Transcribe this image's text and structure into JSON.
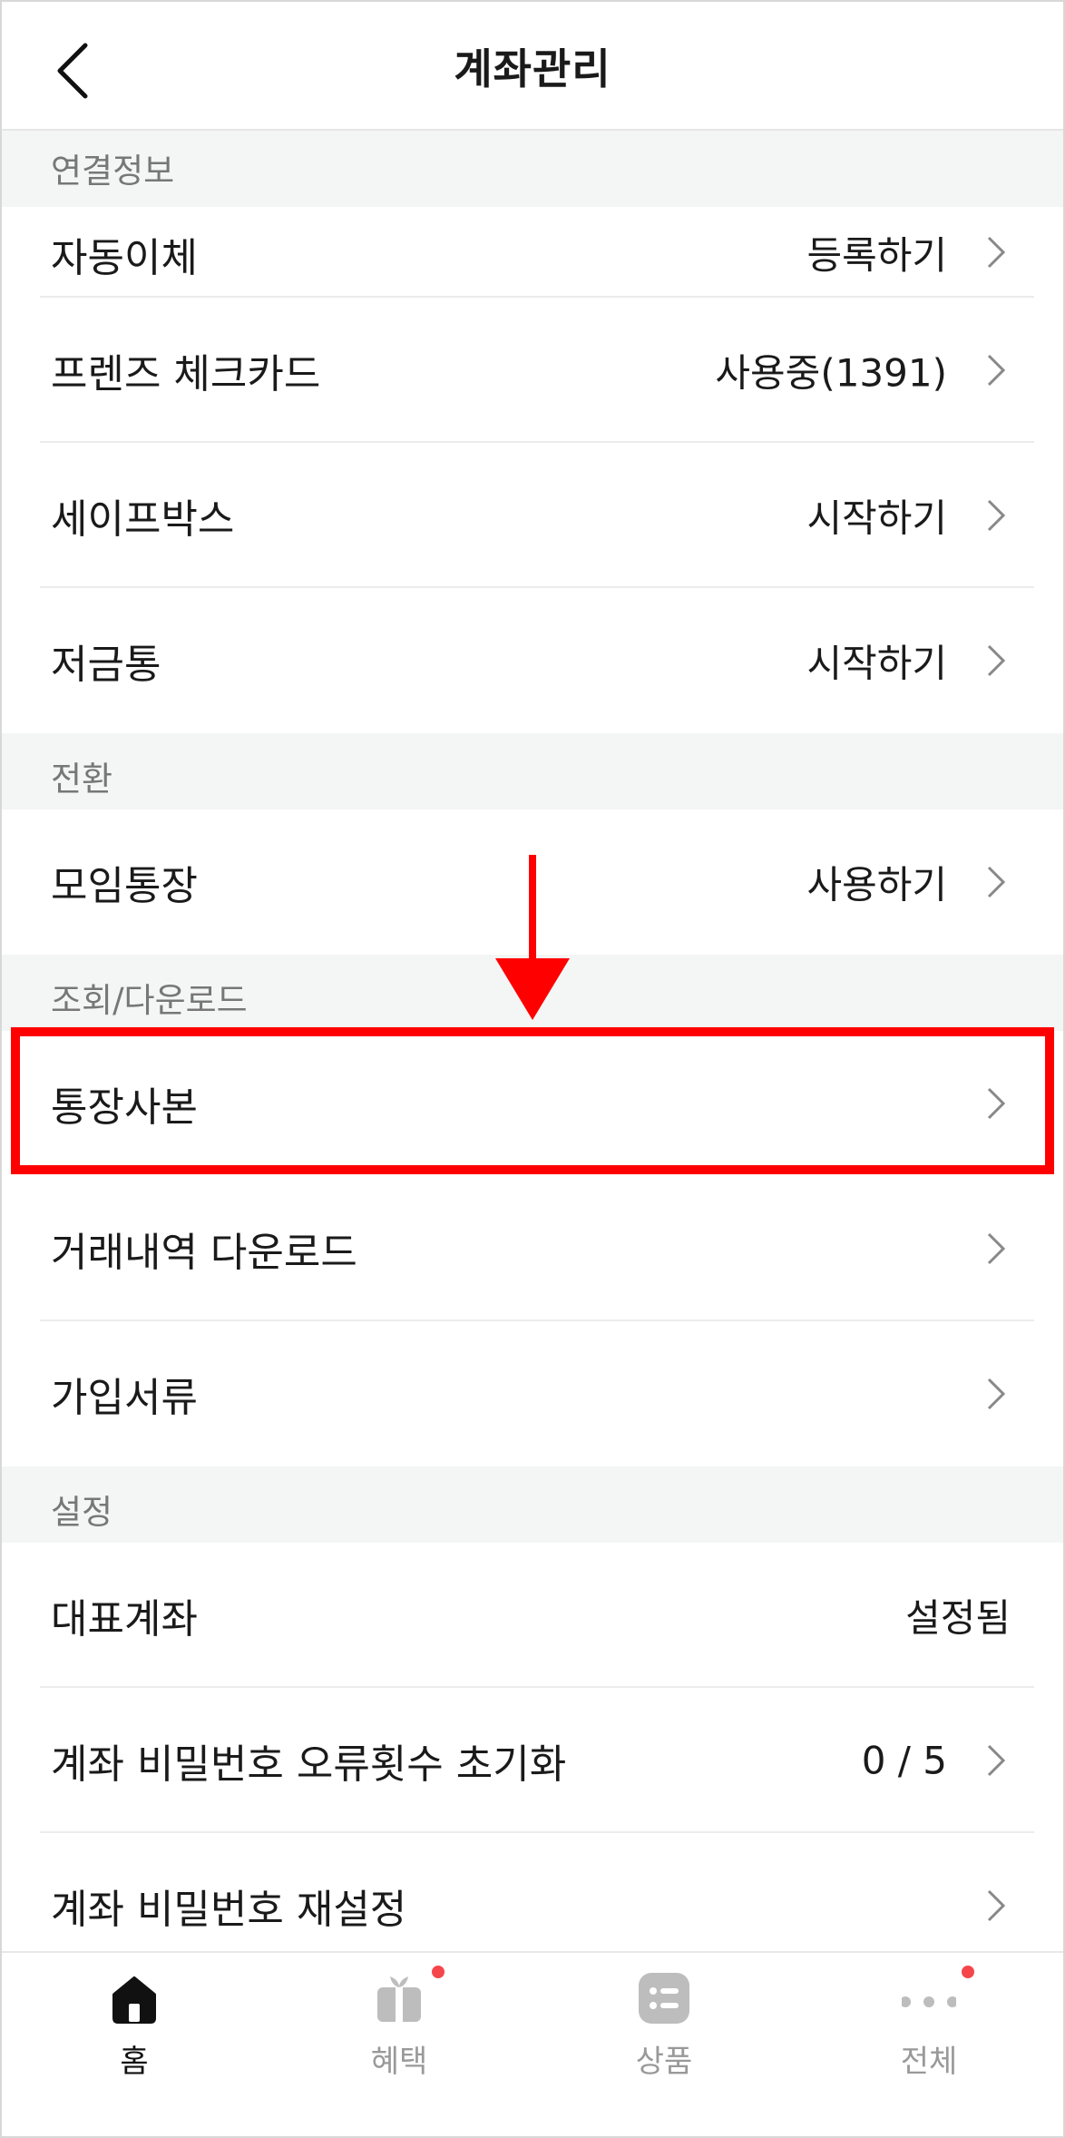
{
  "header": {
    "title": "계좌관리",
    "back_icon": "chevron-left-icon"
  },
  "sections": {
    "link_info": "연결정보",
    "switch": "전환",
    "lookup": "조회/다운로드",
    "settings": "설정"
  },
  "rows": {
    "auto_transfer": {
      "label": "자동이체",
      "value": "등록하기"
    },
    "check_card": {
      "label": "프렌즈 체크카드",
      "value": "사용중(1391)"
    },
    "safe_box": {
      "label": "세이프박스",
      "value": "시작하기"
    },
    "piggy_bank": {
      "label": "저금통",
      "value": "시작하기"
    },
    "group_account": {
      "label": "모임통장",
      "value": "사용하기"
    },
    "bankbook_copy": {
      "label": "통장사본"
    },
    "history_download": {
      "label": "거래내역 다운로드"
    },
    "signup_docs": {
      "label": "가입서류"
    },
    "main_account": {
      "label": "대표계좌",
      "value": "설정됨"
    },
    "pw_error_reset": {
      "label": "계좌 비밀번호 오류횟수 초기화",
      "value": "0 / 5"
    },
    "pw_reset": {
      "label": "계좌 비밀번호 재설정"
    }
  },
  "nav": {
    "home": {
      "label": "홈",
      "icon": "home-icon"
    },
    "benefits": {
      "label": "혜택",
      "icon": "gift-icon"
    },
    "products": {
      "label": "상품",
      "icon": "list-icon"
    },
    "all": {
      "label": "전체",
      "icon": "more-dots-icon"
    }
  },
  "colors": {
    "highlight": "#ff0000",
    "badge": "#f5464b",
    "section_bg": "#f4f5f5"
  }
}
